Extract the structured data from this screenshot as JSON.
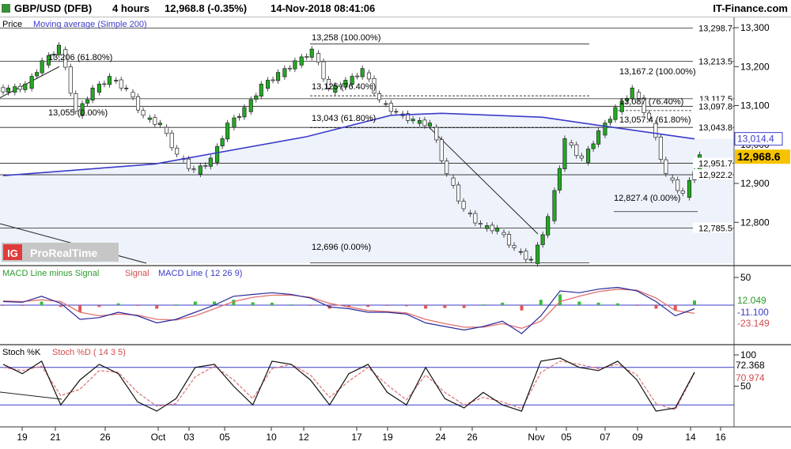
{
  "header": {
    "instrument": "GBP/USD (DFB)",
    "timeframe": "4 hours",
    "last": "12,968.8 (-0.35%)",
    "datetime": "14-Nov-2018 08:41:06",
    "source": "IT-Finance.com"
  },
  "price_panel": {
    "legend_price": "Price",
    "legend_ma": "Moving average (Simple 200)",
    "watermark_logo": "IG",
    "watermark_text": "ProRealTime",
    "y_ticks": [
      "13,300",
      "13,200",
      "13,100",
      "13,000",
      "12,900",
      "12,800"
    ],
    "right_levels": [
      "13,298.7",
      "13,213.5",
      "13,117.5",
      "13,097.8",
      "13,043.8",
      "12,951.7",
      "12,922.2",
      "12,785.5"
    ],
    "ma_badge": "13,014.4",
    "price_badge": "12,968.6",
    "fib_labels": [
      "13,258 (100.00%)",
      "13,206 (61.80%)",
      "13,125 (76.40%)",
      "13,055 (0.00%)",
      "13,043 (61.80%)",
      "12,696 (0.00%)",
      "13,167.2 (100.00%)",
      "13,087 (76.40%)",
      "13,057.4 (61.80%)",
      "12,827.4 (0.00%)"
    ]
  },
  "macd_panel": {
    "legend_hist": "MACD Line minus Signal",
    "legend_signal": "Signal",
    "legend_macd": "MACD Line ( 12 26 9)",
    "y_tick": "50",
    "badge_hist": "12.049",
    "badge_macd": "-11.100",
    "badge_signal": "-23.149"
  },
  "stoch_panel": {
    "legend_k": "Stoch %K",
    "legend_d": "Stoch %D ( 14 3 5)",
    "y_ticks": [
      "100",
      "50"
    ],
    "badge_k": "72.368",
    "badge_d": "70.974"
  },
  "x_axis": {
    "labels": [
      "19",
      "21",
      "26",
      "Oct",
      "03",
      "05",
      "10",
      "12",
      "17",
      "19",
      "24",
      "26",
      "Nov",
      "05",
      "07",
      "09",
      "14",
      "16"
    ]
  },
  "chart_data": {
    "type": "line",
    "series": [
      {
        "name": "Price",
        "x": [
          "Sep 18",
          "Sep 19",
          "Sep 20",
          "Sep 21",
          "Sep 24",
          "Sep 25",
          "Sep 26",
          "Sep 27",
          "Sep 28",
          "Oct 01",
          "Oct 02",
          "Oct 03",
          "Oct 04",
          "Oct 05",
          "Oct 08",
          "Oct 09",
          "Oct 10",
          "Oct 11",
          "Oct 12",
          "Oct 15",
          "Oct 16",
          "Oct 17",
          "Oct 18",
          "Oct 19",
          "Oct 22",
          "Oct 23",
          "Oct 24",
          "Oct 25",
          "Oct 26",
          "Oct 29",
          "Oct 30",
          "Oct 31",
          "Nov 01",
          "Nov 02",
          "Nov 05",
          "Nov 06",
          "Nov 07",
          "Nov 08",
          "Nov 09",
          "Nov 12",
          "Nov 13",
          "Nov 14"
        ],
        "values": [
          13140,
          13150,
          13210,
          13250,
          13080,
          13140,
          13170,
          13140,
          13070,
          13050,
          12970,
          12930,
          12960,
          13050,
          13090,
          13150,
          13180,
          13210,
          13240,
          13140,
          13160,
          13190,
          13110,
          13080,
          13060,
          13050,
          12920,
          12830,
          12790,
          12780,
          12730,
          12700,
          12810,
          13010,
          12960,
          13030,
          13090,
          13140,
          13060,
          12920,
          12870,
          12968.6
        ]
      },
      {
        "name": "Moving average (Simple 200)",
        "x": [
          "Sep 18",
          "Oct 01",
          "Oct 12",
          "Oct 19",
          "Oct 24",
          "Nov 01",
          "Nov 07",
          "Nov 14"
        ],
        "values": [
          12920,
          12950,
          13020,
          13075,
          13080,
          13070,
          13045,
          13014.4
        ]
      }
    ],
    "ylim": [
      12690,
      13310
    ],
    "grid": true
  }
}
